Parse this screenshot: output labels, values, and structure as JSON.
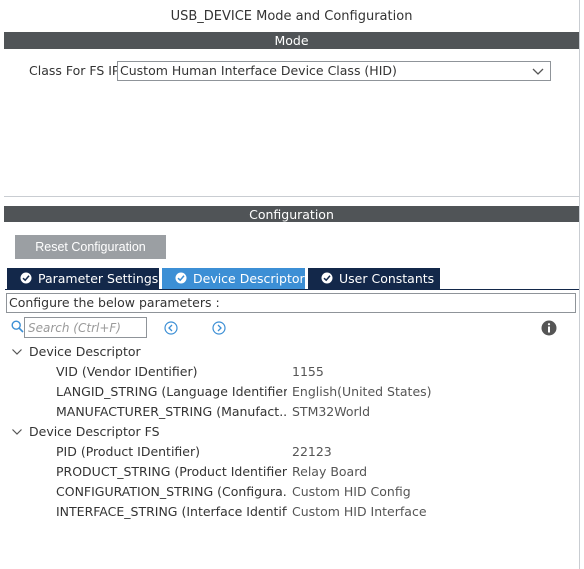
{
  "window": {
    "title": "USB_DEVICE Mode and Configuration"
  },
  "mode": {
    "header": "Mode",
    "class_label": "Class For FS IP",
    "class_value": "Custom Human Interface Device Class (HID)"
  },
  "configuration": {
    "header": "Configuration",
    "reset_label": "Reset Configuration",
    "tabs": [
      {
        "label": "Parameter Settings",
        "active": false
      },
      {
        "label": "Device Descriptor",
        "active": true
      },
      {
        "label": "User Constants",
        "active": false
      }
    ],
    "hint": "Configure the below parameters :",
    "search_placeholder": "Search (Ctrl+F)",
    "tree": [
      {
        "group": "Device Descriptor",
        "params": [
          {
            "name": "VID (Vendor IDentifier)",
            "value": "1155"
          },
          {
            "name": "LANGID_STRING (Language Identifier)",
            "value": "English(United States)"
          },
          {
            "name": "MANUFACTURER_STRING (Manufact...",
            "value": "STM32World"
          }
        ]
      },
      {
        "group": "Device Descriptor FS",
        "params": [
          {
            "name": "PID (Product IDentifier)",
            "value": "22123"
          },
          {
            "name": "PRODUCT_STRING (Product Identifier)",
            "value": "Relay Board"
          },
          {
            "name": "CONFIGURATION_STRING (Configura...",
            "value": "Custom HID Config"
          },
          {
            "name": "INTERFACE_STRING (Interface Identifi...",
            "value": "Custom HID Interface"
          }
        ]
      }
    ]
  },
  "colors": {
    "section_bar": "#505457",
    "tab_dark": "#13284a",
    "tab_active": "#3c8fd5",
    "reset_button": "#9b9fa3"
  },
  "icons": {
    "select_chevron": "chevron-down-icon",
    "tab_check": "check-circle-icon",
    "search": "search-icon",
    "prev": "arrow-left-circle-icon",
    "next": "arrow-right-circle-icon",
    "info": "info-icon",
    "tree_expand": "chevron-down-icon"
  }
}
